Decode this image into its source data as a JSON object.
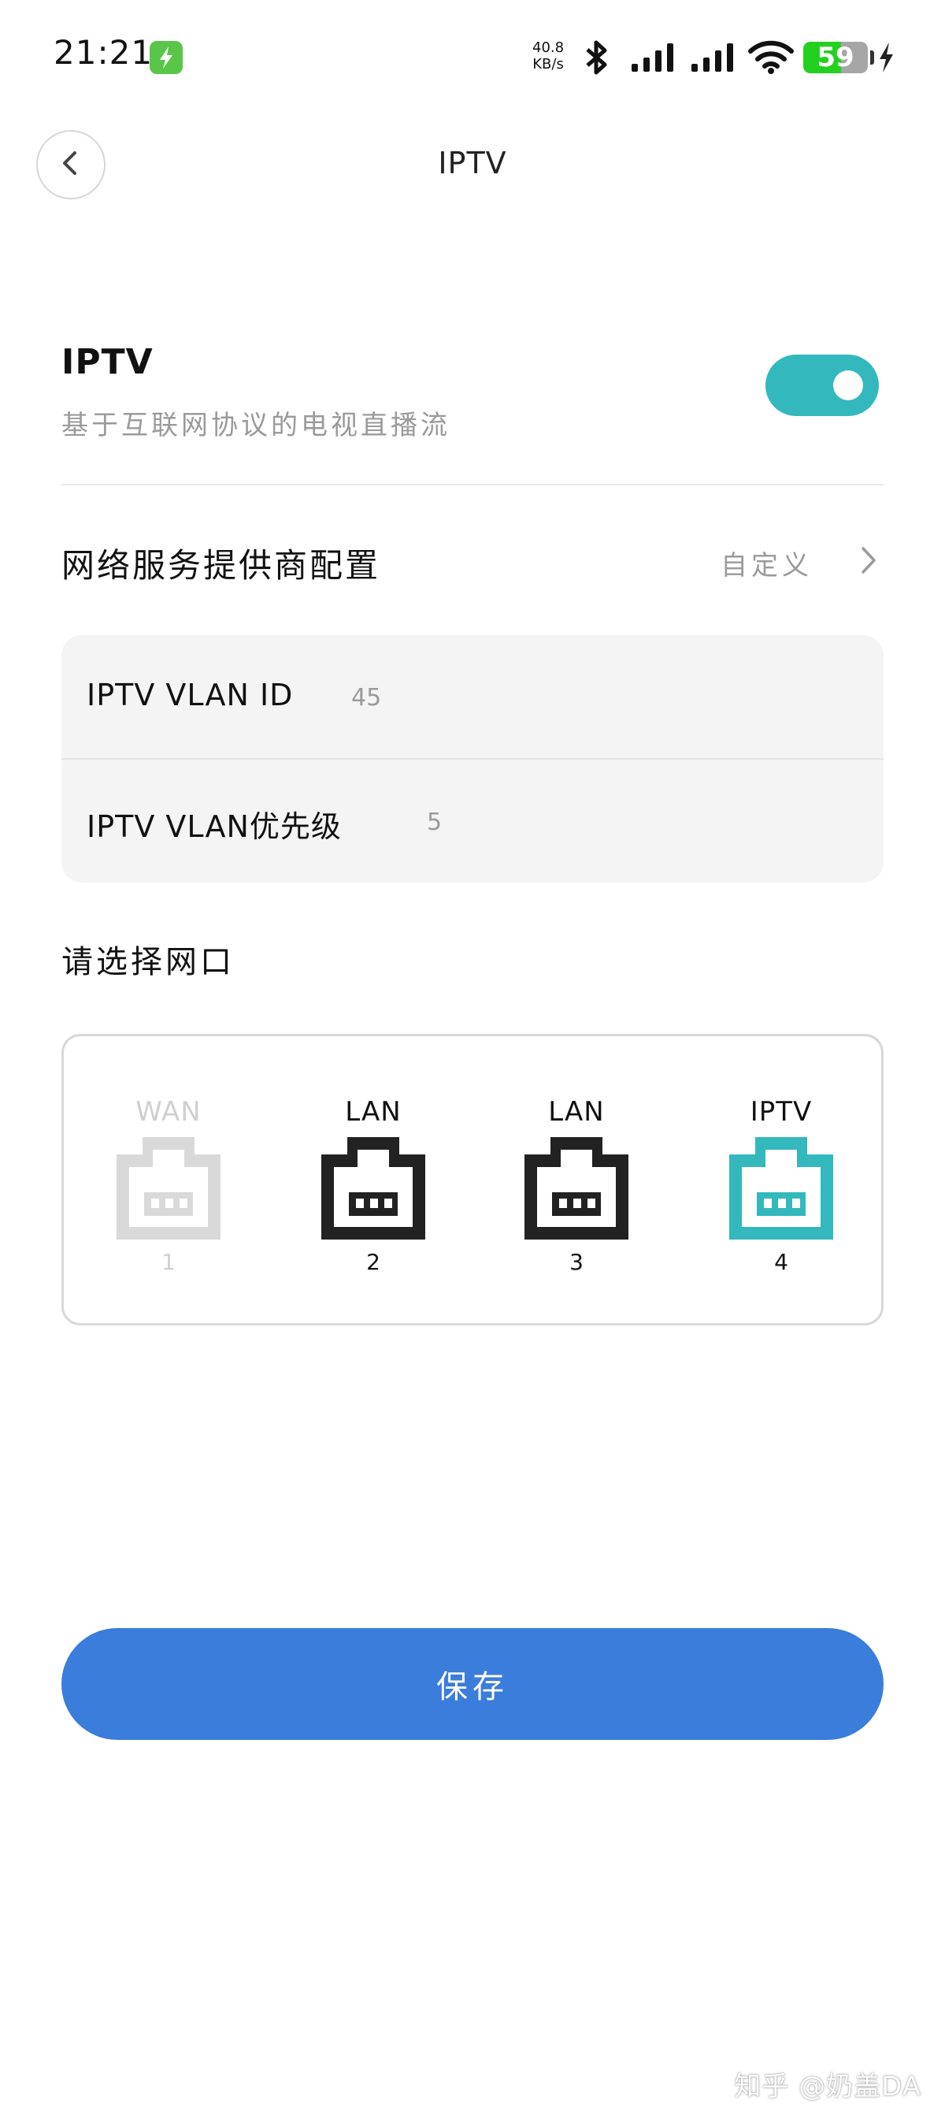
{
  "status_bar": {
    "time": "21:21",
    "net_speed_value": "40.8",
    "net_speed_unit": "KB/s",
    "battery_level": "59",
    "battery_fraction": 0.59
  },
  "header": {
    "title": "IPTV"
  },
  "iptv": {
    "title": "IPTV",
    "description": "基于互联网协议的电视直播流",
    "enabled": true,
    "accent_color": "#33b8bd"
  },
  "provider": {
    "label": "网络服务提供商配置",
    "value": "自定义"
  },
  "vlan": {
    "id_label": "IPTV VLAN ID",
    "id_value": "45",
    "priority_label": "IPTV VLAN优先级",
    "priority_value": "5"
  },
  "ports": {
    "title": "请选择网口",
    "items": [
      {
        "type": "WAN",
        "number": "1",
        "state": "disabled",
        "color": "#d9d9d9"
      },
      {
        "type": "LAN",
        "number": "2",
        "state": "normal",
        "color": "#222222"
      },
      {
        "type": "LAN",
        "number": "3",
        "state": "normal",
        "color": "#222222"
      },
      {
        "type": "IPTV",
        "number": "4",
        "state": "selected",
        "color": "#33b8bd"
      }
    ]
  },
  "save": {
    "label": "保存",
    "color": "#3b7ddb"
  },
  "watermark": {
    "text": "知乎 @奶盖DA"
  }
}
